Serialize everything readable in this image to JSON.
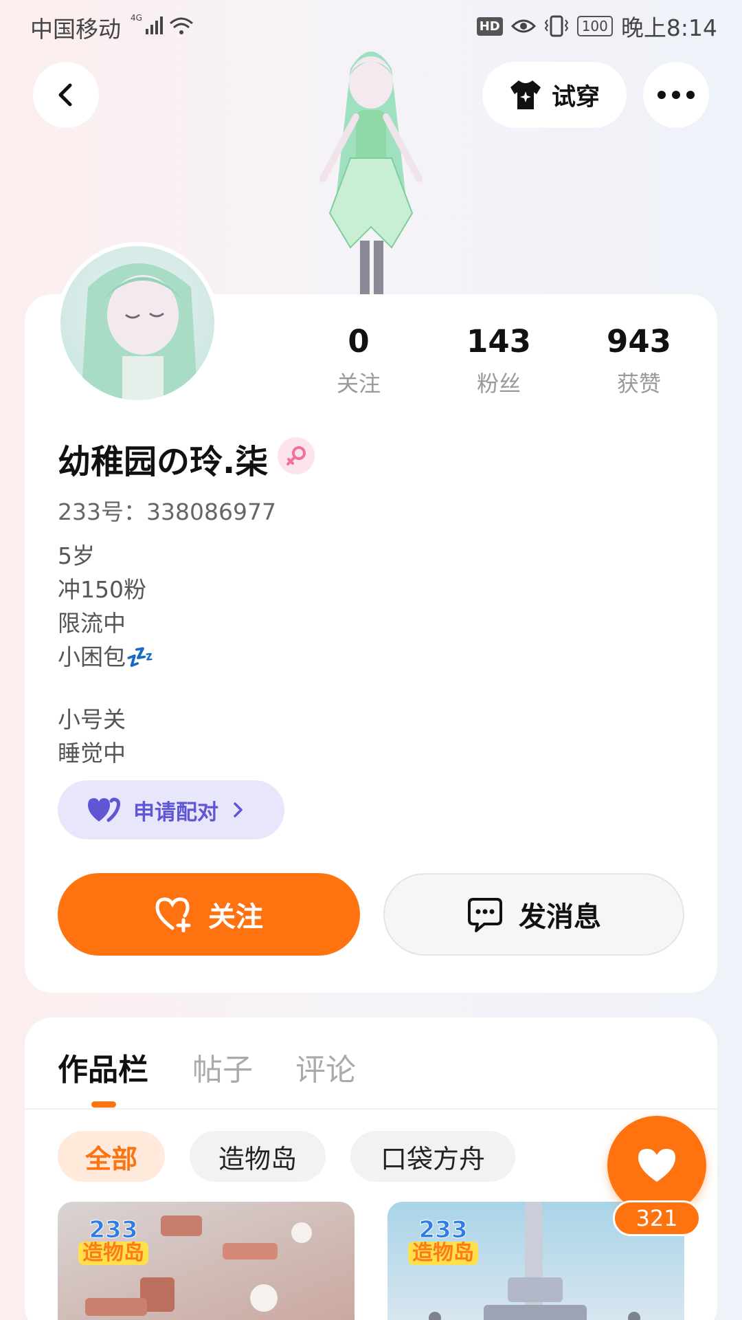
{
  "status_bar": {
    "carrier": "中国移动",
    "network": "4G",
    "hd": "HD",
    "battery": "100",
    "time": "晚上8:14"
  },
  "top_bar": {
    "try_on_label": "试穿"
  },
  "profile": {
    "stats": [
      {
        "value": "0",
        "label": "关注"
      },
      {
        "value": "143",
        "label": "粉丝"
      },
      {
        "value": "943",
        "label": "获赞"
      }
    ],
    "username": "幼稚园の玲.柒",
    "user_id": "233号：338086977",
    "bio_lines": [
      "5岁",
      "冲150粉",
      "限流中",
      "小困包💤"
    ],
    "bio_lines_2": [
      "小号关",
      "睡觉中"
    ],
    "pair_button": "申请配对",
    "follow_button": "关注",
    "message_button": "发消息"
  },
  "works": {
    "tabs": [
      {
        "label": "作品栏",
        "active": true
      },
      {
        "label": "帖子",
        "active": false
      },
      {
        "label": "评论",
        "active": false
      }
    ],
    "filters": [
      {
        "label": "全部",
        "active": true
      },
      {
        "label": "造物岛",
        "active": false
      },
      {
        "label": "口袋方舟",
        "active": false
      }
    ],
    "thumbnails": [
      {
        "logo_number": "233",
        "logo_text": "造物岛"
      },
      {
        "logo_number": "233",
        "logo_text": "造物岛"
      }
    ]
  },
  "like_fab": {
    "count": "321"
  },
  "colors": {
    "accent": "#ff7210",
    "pair_purple": "#5f56d6",
    "pair_bg": "#e8e6fb"
  }
}
